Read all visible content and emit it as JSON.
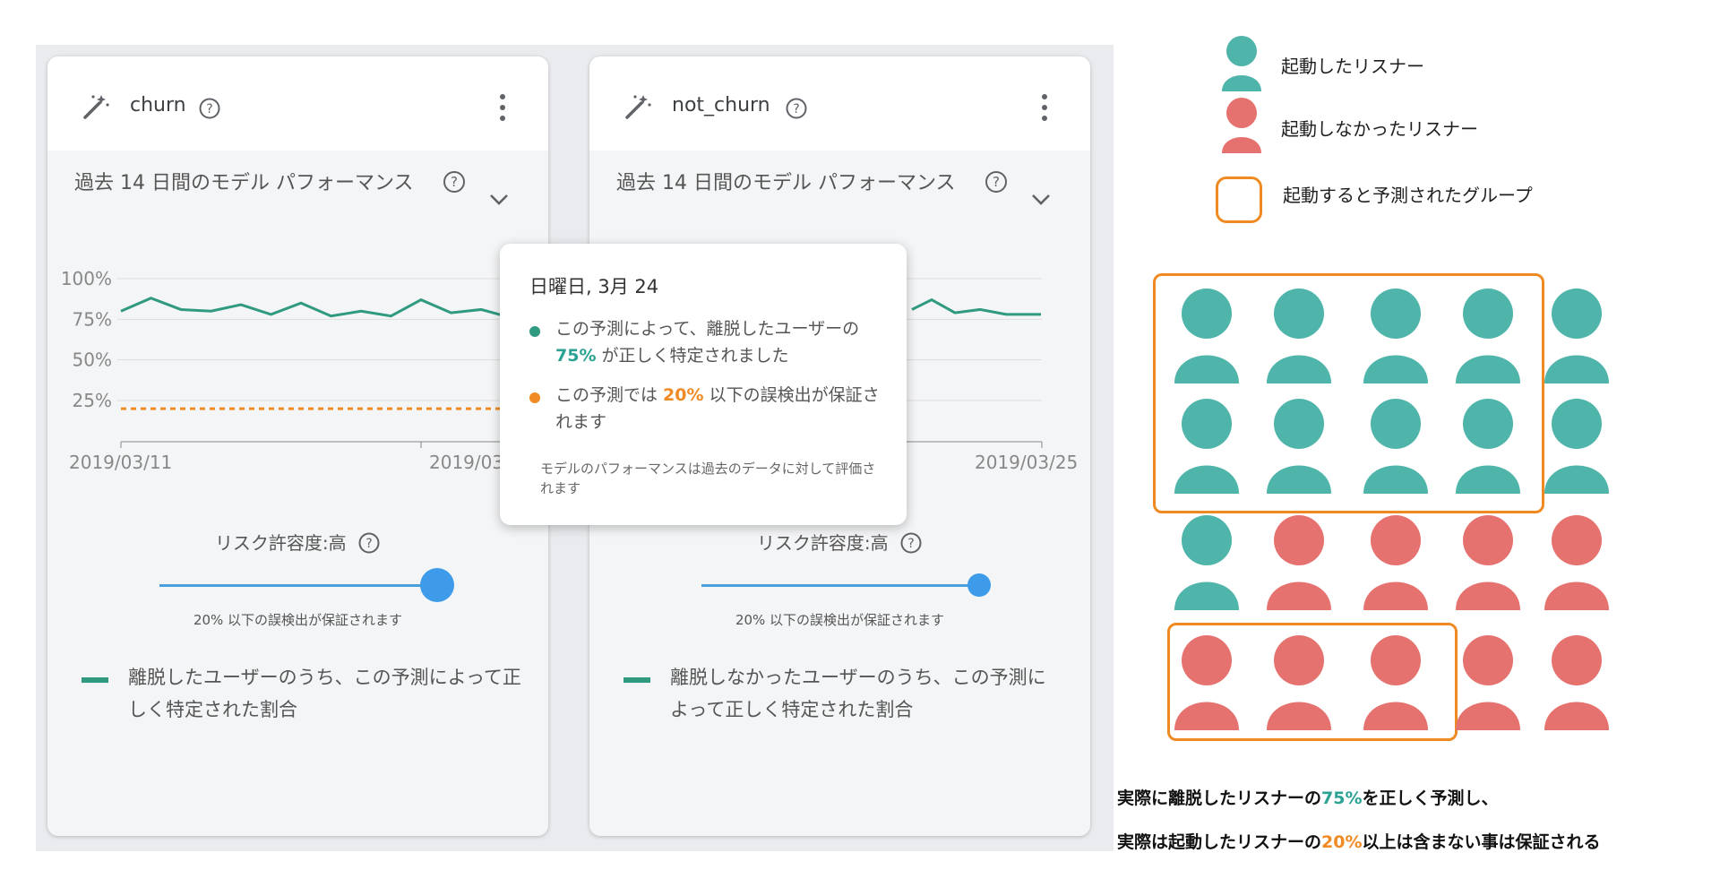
{
  "colors": {
    "teal": "#4fb5ab",
    "salmon": "#e6726f",
    "orange": "#ef8a22",
    "chart_line": "#2f9a7f",
    "chart_threshold": "#f08a24",
    "slider": "#3d9be9"
  },
  "cards": [
    {
      "model_name": "churn",
      "perf_title": "過去 14 日間のモデル パフォーマンス",
      "risk_label": "リスク許容度:高",
      "slider_note": "20% 以下の誤検出が保証されます",
      "slider_value": 1.0,
      "legend_text": "離脱したユーザーのうち、この予測によって正しく特定された割合",
      "chart_data": {
        "type": "line",
        "x": [
          "2019/03/11",
          "2019/03/12",
          "2019/03/13",
          "2019/03/14",
          "2019/03/15",
          "2019/03/16",
          "2019/03/17",
          "2019/03/18",
          "2019/03/19",
          "2019/03/20",
          "2019/03/21",
          "2019/03/22",
          "2019/03/23",
          "2019/03/24",
          "2019/03/25"
        ],
        "series": [
          {
            "values": [
              80,
              88,
              81,
              80,
              84,
              78,
              85,
              77,
              80,
              77,
              87,
              79,
              81,
              76,
              79
            ]
          },
          {
            "values": [
              20,
              20,
              20,
              20,
              20,
              20,
              20,
              20,
              20,
              20,
              20,
              20,
              20,
              20,
              20
            ]
          }
        ],
        "highlight_index": 13,
        "ylim": [
          0,
          100
        ],
        "yticks": [
          "100%",
          "75%",
          "50%",
          "25%"
        ],
        "xtick_labels": [
          "2019/03/11",
          "2019/03/"
        ],
        "visible_until_index": 14
      }
    },
    {
      "model_name": "not_churn",
      "perf_title": "過去 14 日間のモデル パフォーマンス",
      "risk_label": "リスク許容度:高",
      "slider_note": "20% 以下の誤検出が保証されます",
      "slider_value": 1.0,
      "legend_text": "離脱しなかったユーザーのうち、この予測によって正しく特定された割合",
      "chart_data": {
        "type": "line",
        "x": [
          "2019/03/20",
          "2019/03/21",
          "2019/03/22",
          "2019/03/23",
          "2019/03/24",
          "2019/03/25"
        ],
        "series": [
          {
            "values": [
              81,
              87,
              79,
              81,
              78,
              78
            ]
          }
        ],
        "ylim": [
          0,
          100
        ],
        "xtick_labels": [
          "2019/03/25"
        ]
      }
    }
  ],
  "tooltip": {
    "date": "日曜日, 3月 24",
    "line1_a": "この予測によって、離脱したユーザーの ",
    "line1_value": "75%",
    "line1_b": " が正しく特定されました",
    "line2_a": "この予測では ",
    "line2_value": "20%",
    "line2_b": " 以下の誤検出が保証されます",
    "note": "モデルのパフォーマンスは過去のデータに対して評価されます"
  },
  "legend": {
    "started": "起動したリスナー",
    "not_started": "起動しなかったリスナー",
    "predicted_group": "起動すると予測されたグループ"
  },
  "people_grid": [
    [
      "teal",
      "teal",
      "teal",
      "teal",
      "teal"
    ],
    [
      "teal",
      "teal",
      "teal",
      "teal",
      "teal"
    ],
    [
      "teal",
      "salmon",
      "salmon",
      "salmon",
      "salmon"
    ],
    [
      "salmon",
      "salmon",
      "salmon",
      "salmon",
      "salmon"
    ]
  ],
  "caption": {
    "line1_a": "実際に離脱したリスナーの",
    "line1_value": "75%",
    "line1_b": "を正しく予測し、",
    "line2_a": "実際は起動したリスナーの",
    "line2_value": "20%",
    "line2_b": "以上は含まない事は保証される"
  }
}
